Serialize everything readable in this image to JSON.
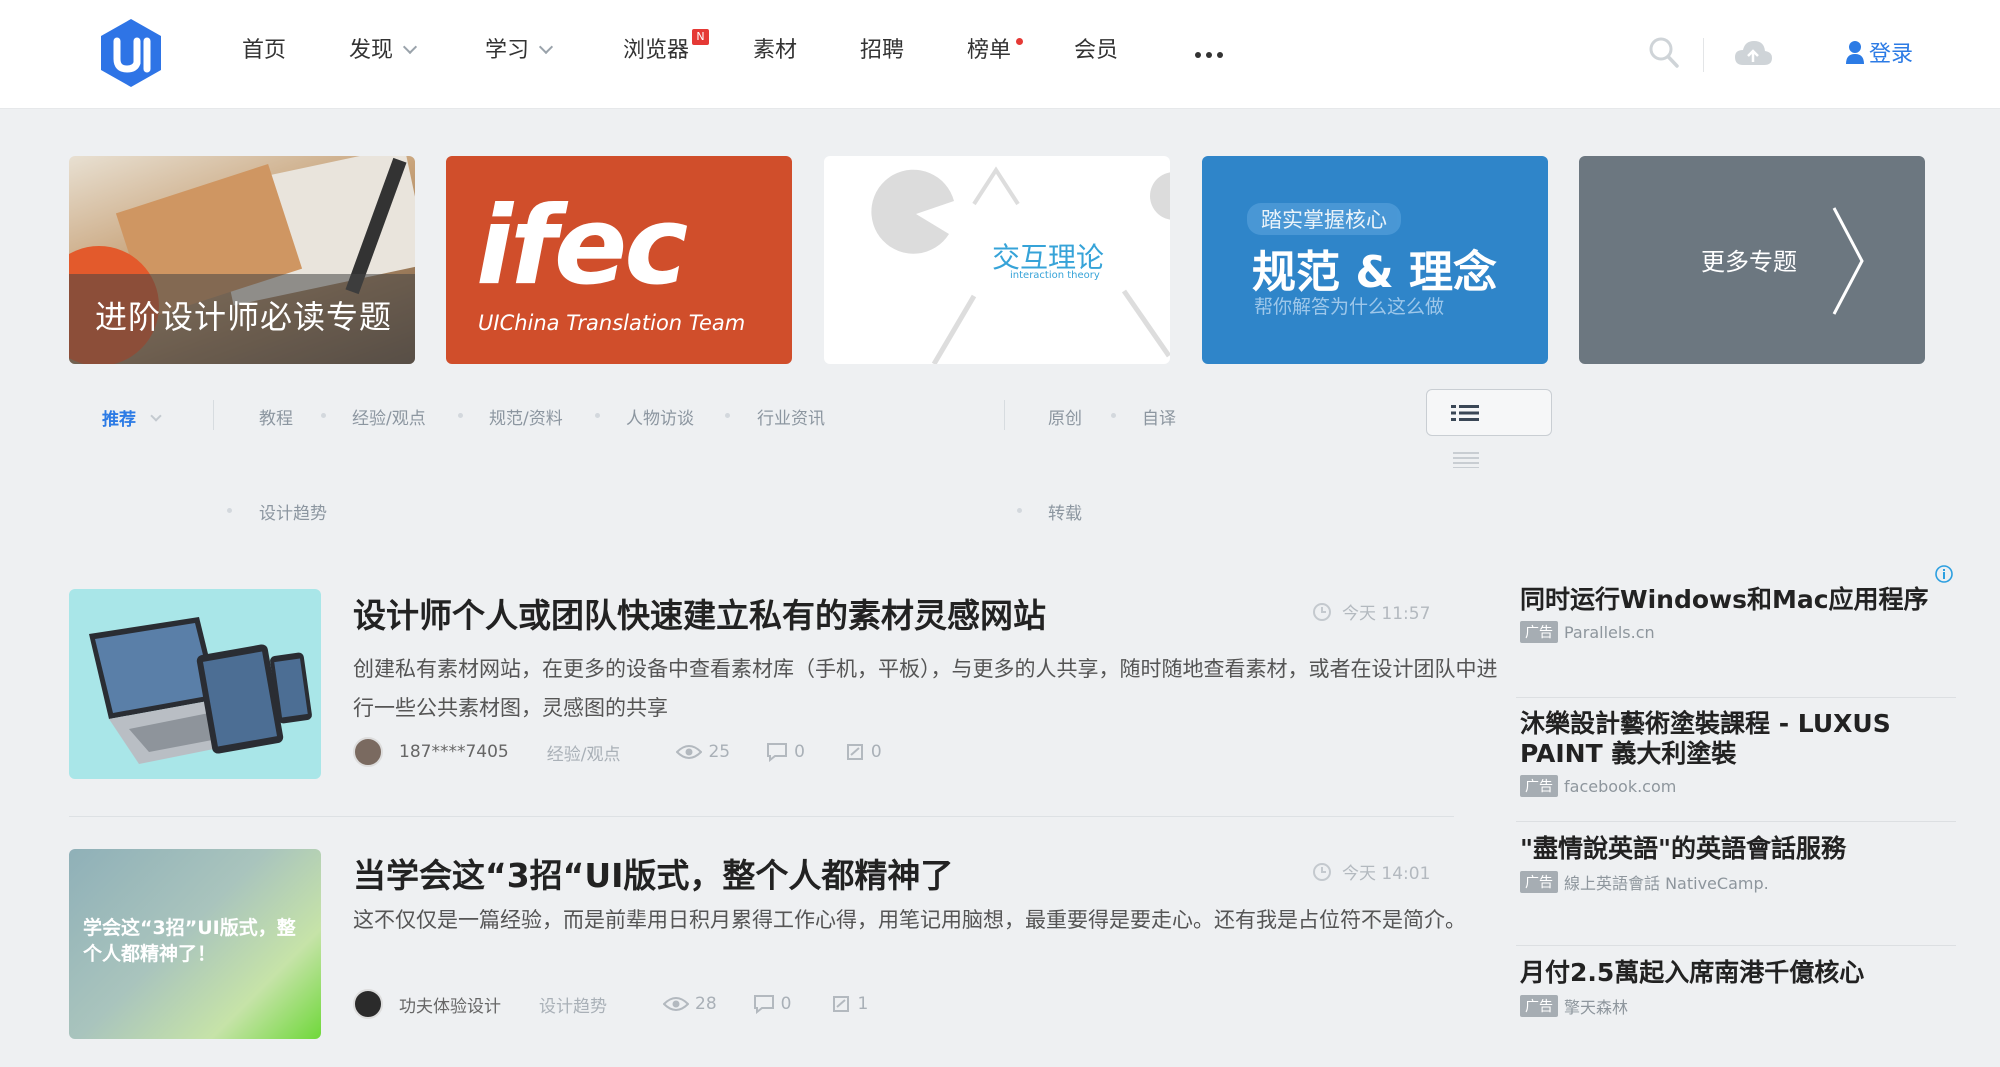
{
  "header": {
    "logo_text": "UI",
    "nav": [
      {
        "label": "首页"
      },
      {
        "label": "发现"
      },
      {
        "label": "学习"
      },
      {
        "label": "浏览器",
        "badge": "N"
      },
      {
        "label": "素材"
      },
      {
        "label": "招聘"
      },
      {
        "label": "榜单"
      },
      {
        "label": "会员"
      }
    ],
    "login_label": "登录",
    "icons": [
      "search-icon",
      "cloud-upload-icon",
      "user-icon",
      "more-icon"
    ]
  },
  "banners": [
    {
      "title": "进阶设计师必读专题"
    },
    {
      "big": "ifec",
      "subtitle": "UIChina Translation Team"
    },
    {
      "title": "交互理论",
      "subtitle": "interaction theory"
    },
    {
      "tag": "踏实掌握核心",
      "title": "规范 & 理念",
      "subtitle": "帮你解答为什么这么做"
    },
    {
      "title": "更多专题"
    }
  ],
  "filters": {
    "active": "推荐",
    "categories": [
      "教程",
      "经验/观点",
      "规范/资料",
      "人物访谈",
      "行业资讯",
      "设计趋势"
    ],
    "sources": [
      "原创",
      "自译",
      "转载"
    ]
  },
  "articles": [
    {
      "title": "设计师个人或团队快速建立私有的素材灵感网站",
      "time": "今天 11:57",
      "desc": "创建私有素材网站，在更多的设备中查看素材库（手机，平板），与更多的人共享，随时随地查看素材，或者在设计团队中进行一些公共素材图，灵感图的共享",
      "author": "187****7405",
      "category": "经验/观点",
      "views": "25",
      "comments": "0",
      "collects": "0"
    },
    {
      "title": "当学会这“3招“UI版式，整个人都精神了",
      "thumb_text": "学会这“3招”UI版式，整个人都精神了！",
      "time": "今天 14:01",
      "desc": "这不仅仅是一篇经验，而是前辈用日积月累得工作心得，用笔记用脑想，最重要得是要走心。还有我是占位符不是简介。",
      "author": "功夫体验设计",
      "category": "设计趋势",
      "views": "28",
      "comments": "0",
      "collects": "1"
    }
  ],
  "ads": [
    {
      "title": "同时运行Windows和Mac应用程序",
      "badge": "广告",
      "source": "Parallels.cn"
    },
    {
      "title": "沐樂設計藝術塗裝課程 - LUXUS PAINT 義大利塗裝",
      "badge": "广告",
      "source": "facebook.com"
    },
    {
      "title": "\"盡情說英語\"的英語會話服務",
      "badge": "广告",
      "source": "線上英語會話 NativeCamp."
    },
    {
      "title": "月付2.5萬起入席南港千億核心",
      "badge": "广告",
      "source": "擎天森林"
    }
  ]
}
